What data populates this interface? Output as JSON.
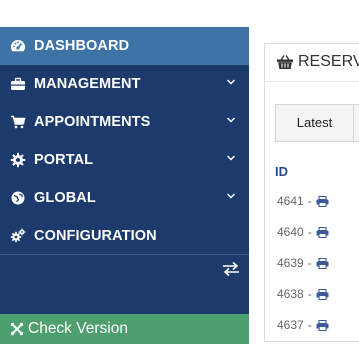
{
  "sidebar": {
    "items": [
      {
        "label": "DASHBOARD",
        "icon": "dashboard-gauge-icon",
        "active": true,
        "has_submenu": false
      },
      {
        "label": "MANAGEMENT",
        "icon": "briefcase-icon",
        "active": false,
        "has_submenu": true
      },
      {
        "label": "APPOINTMENTS",
        "icon": "cart-icon",
        "active": false,
        "has_submenu": true
      },
      {
        "label": "PORTAL",
        "icon": "gear-icon",
        "active": false,
        "has_submenu": true
      },
      {
        "label": "GLOBAL",
        "icon": "globe-icon",
        "active": false,
        "has_submenu": true
      },
      {
        "label": "CONFIGURATION",
        "icon": "cogs-icon",
        "active": false,
        "has_submenu": false
      }
    ],
    "toggle_icon": "exchange-arrows-icon",
    "check_version": {
      "label": "Check Version",
      "icon": "joomla-icon"
    }
  },
  "panel": {
    "title": "RESERVA",
    "title_icon": "basket-icon",
    "tabs": [
      {
        "label": "Latest",
        "active": true
      }
    ],
    "table": {
      "columns": [
        "ID"
      ],
      "rows": [
        {
          "id": "4641",
          "sep": "-"
        },
        {
          "id": "4640",
          "sep": "-"
        },
        {
          "id": "4639",
          "sep": "-"
        },
        {
          "id": "4638",
          "sep": "-"
        },
        {
          "id": "4637",
          "sep": "-"
        }
      ]
    }
  },
  "colors": {
    "sidebar_bg": "#1c3b6c",
    "active_item_bg": "#3e73a6",
    "check_version_bg": "#4e9f6f",
    "link_blue": "#274a8c"
  }
}
